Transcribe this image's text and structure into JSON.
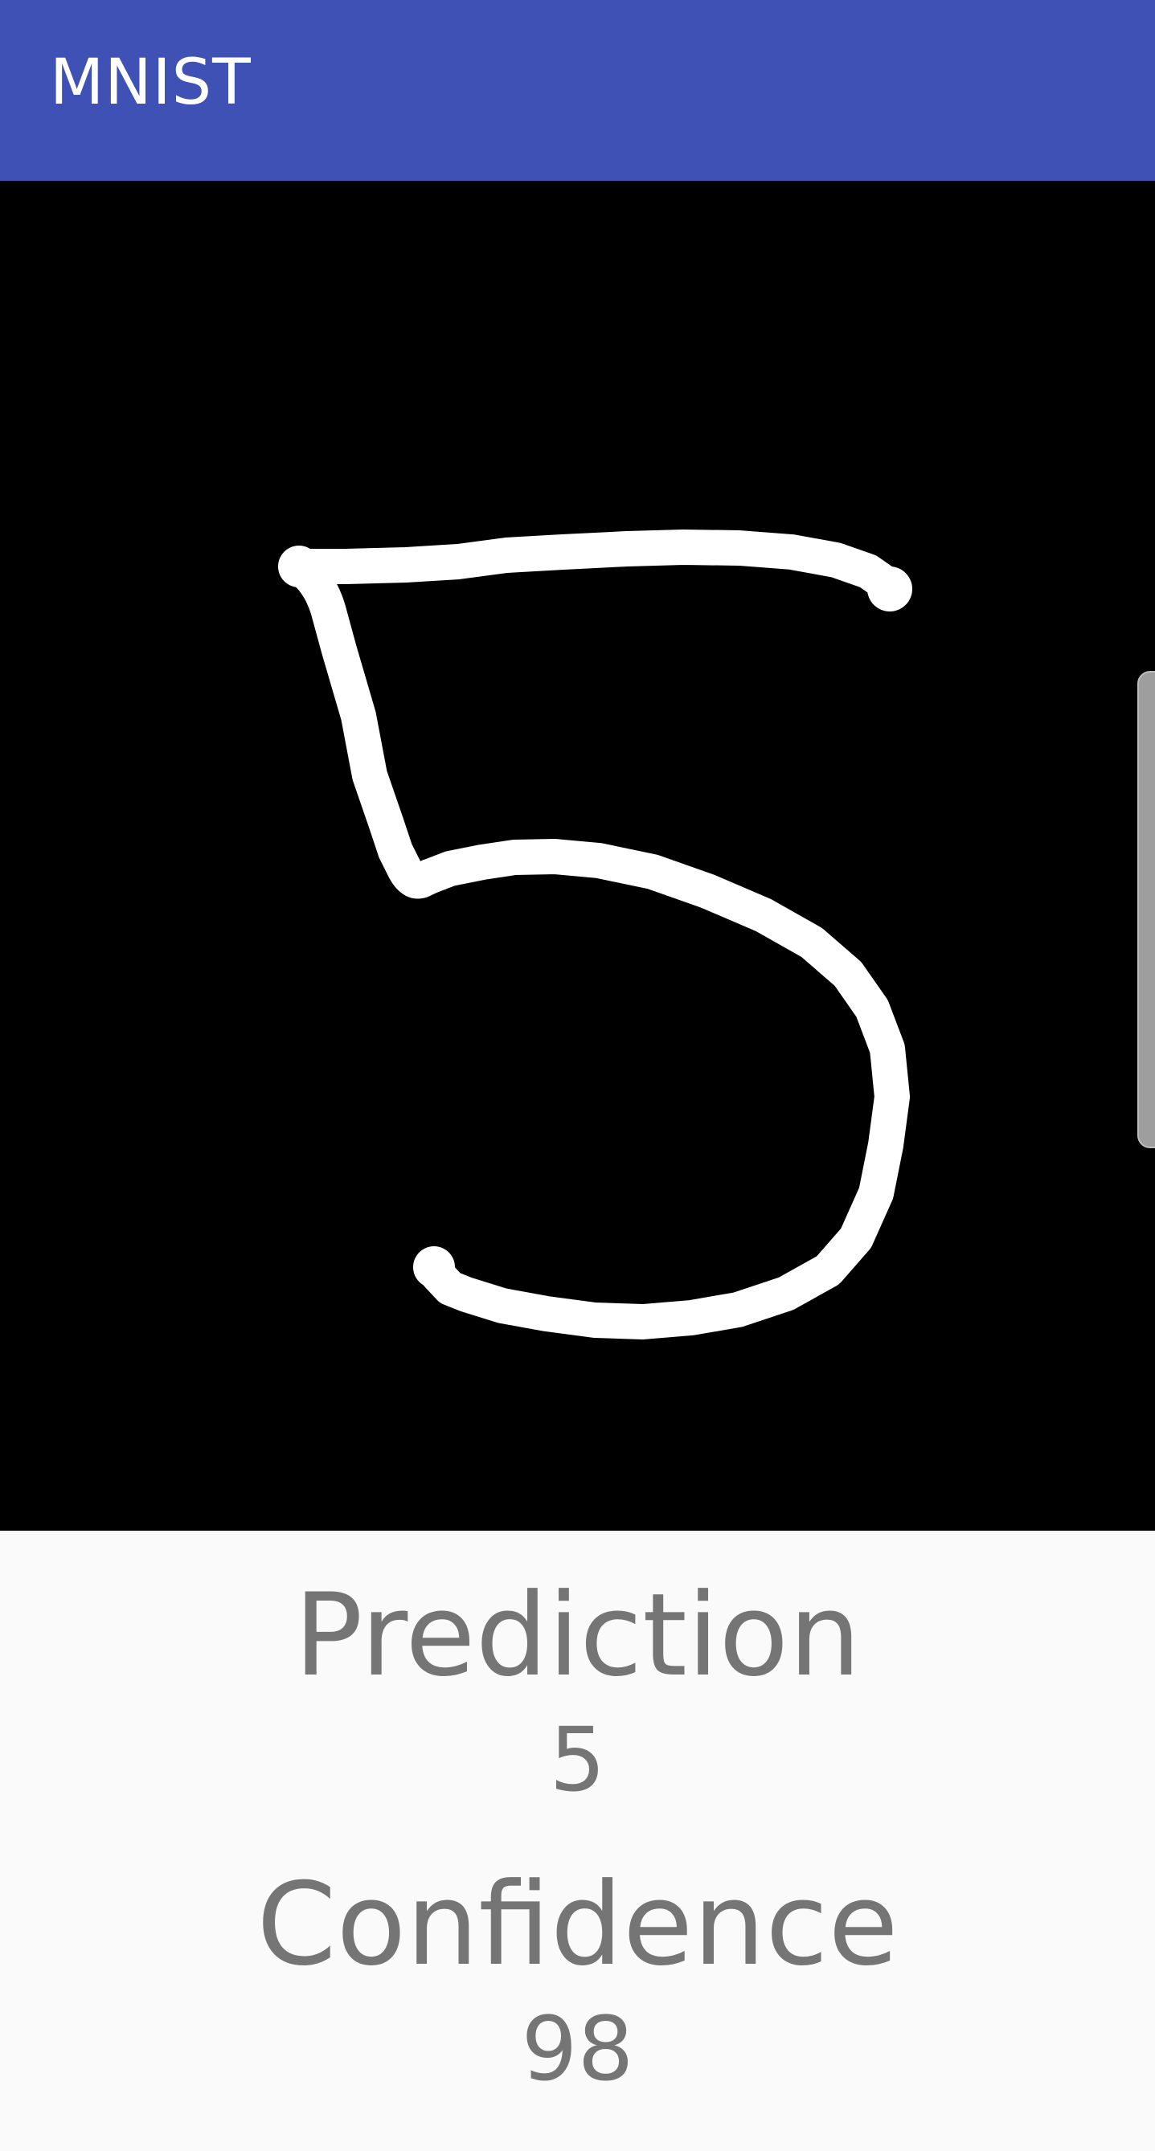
{
  "app_bar": {
    "title": "MNIST",
    "color": "#3f51b5"
  },
  "canvas": {
    "background": "#000000",
    "stroke_color": "#ffffff"
  },
  "results": {
    "prediction_label": "Prediction",
    "prediction_value": "5",
    "confidence_label": "Confidence",
    "confidence_value": "98",
    "text_color": "#757575"
  }
}
